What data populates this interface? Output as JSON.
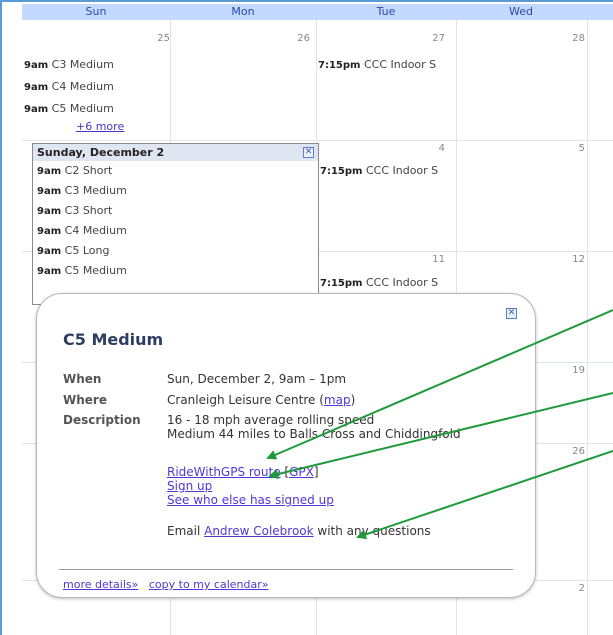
{
  "calendar": {
    "days_of_week": [
      "Sun",
      "Mon",
      "Tue",
      "Wed"
    ],
    "week1": {
      "day_numbers": [
        "25",
        "26",
        "27",
        "28"
      ],
      "sun_events": [
        {
          "time": "9am",
          "title": "C3 Medium"
        },
        {
          "time": "9am",
          "title": "C4 Medium"
        },
        {
          "time": "9am",
          "title": "C5 Medium"
        }
      ],
      "sun_more": "+6 more",
      "tue_event": {
        "time": "7:15pm",
        "title": "CCC Indoor S"
      }
    },
    "week2": {
      "day_numbers": [
        "4",
        "5"
      ],
      "tue_event": {
        "time": "7:15pm",
        "title": "CCC Indoor S"
      }
    },
    "week3": {
      "day_numbers": [
        "11",
        "12"
      ],
      "tue_event": {
        "time": "7:15pm",
        "title": "CCC Indoor S"
      }
    },
    "other_day_numbers": {
      "wed_row4": "19",
      "wed_row5": "26",
      "wed_row6": "2"
    }
  },
  "day_popup": {
    "title": "Sunday, December 2",
    "close_glyph": "✕",
    "events": [
      {
        "time": "9am",
        "title": "C2 Short"
      },
      {
        "time": "9am",
        "title": "C3 Medium"
      },
      {
        "time": "9am",
        "title": "C3 Short"
      },
      {
        "time": "9am",
        "title": "C4 Medium"
      },
      {
        "time": "9am",
        "title": "C5 Long"
      },
      {
        "time": "9am",
        "title": "C5 Medium"
      }
    ]
  },
  "event_bubble": {
    "title": "C5 Medium",
    "close_glyph": "✕",
    "when_label": "When",
    "when_value": "Sun, December 2, 9am – 1pm",
    "where_label": "Where",
    "where_value": "Cranleigh Leisure Centre (",
    "where_map_link": "map",
    "where_close_paren": ")",
    "description_label": "Description",
    "description_line1": "16 - 18 mph average rolling speed",
    "description_line2": "Medium 44 miles to Balls Cross and Chiddingfold",
    "route_link": "RideWithGPS route",
    "gpx_open": " [",
    "gpx_link": "GPX",
    "gpx_close": "]",
    "signup_link": "Sign up",
    "see_signed_up_link": "See who else has signed up",
    "email_prefix": "Email ",
    "email_contact_link": "Andrew Colebrook",
    "email_suffix": " with any questions",
    "more_details_link": "more details»",
    "copy_to_calendar_link": "copy to my calendar»"
  },
  "annotation_colors": {
    "arrow": "#1f9a3a",
    "frame": "#5b9bd5",
    "header_bg": "#c3d9ff"
  }
}
